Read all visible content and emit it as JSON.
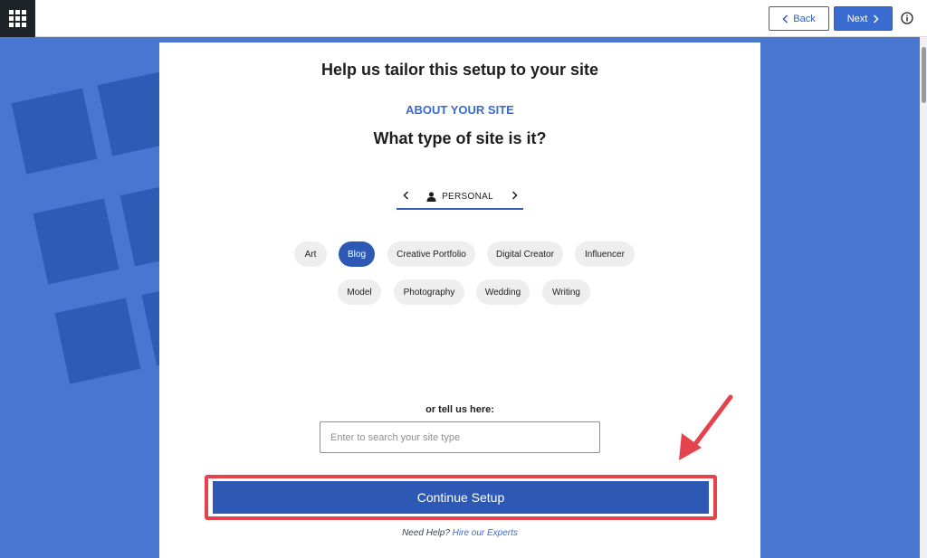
{
  "topbar": {
    "back_label": "Back",
    "next_label": "Next"
  },
  "card": {
    "title": "Help us tailor this setup to your site",
    "eyebrow": "ABOUT YOUR SITE",
    "question": "What type of site is it?",
    "category": "PERSONAL",
    "chips": [
      "Art",
      "Blog",
      "Creative Portfolio",
      "Digital Creator",
      "Influencer",
      "Model",
      "Photography",
      "Wedding",
      "Writing"
    ],
    "selected_chip": "Blog",
    "tell_label": "or tell us here:",
    "search_placeholder": "Enter to search your site type",
    "cta_label": "Continue Setup",
    "help_prefix": "Need Help?",
    "help_link": "Hire our Experts"
  },
  "colors": {
    "accent": "#2d59b4",
    "background": "#4876d1",
    "highlight": "#e5434b"
  },
  "icons": {
    "apps": "grid-icon",
    "back": "chevron-left-icon",
    "next": "chevron-right-icon",
    "info": "info-icon",
    "category": "person-icon"
  }
}
